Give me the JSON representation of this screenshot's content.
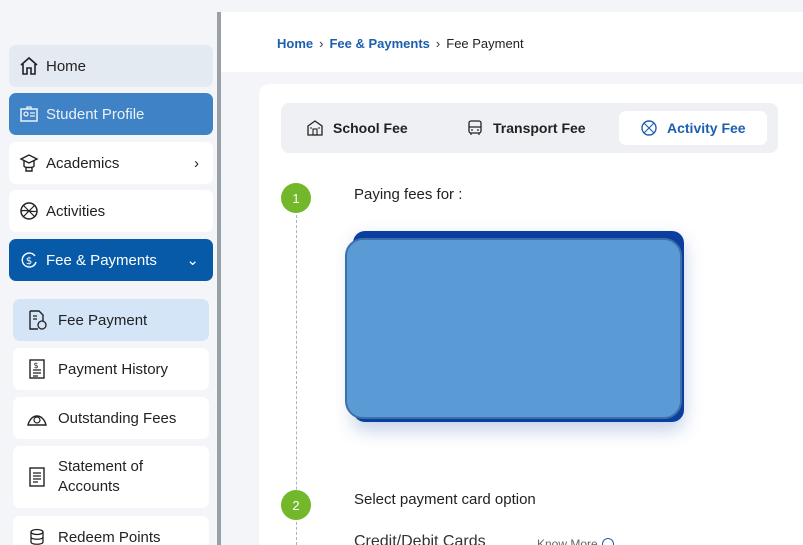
{
  "sidebar": {
    "home": "Home",
    "student_profile": "Student Profile",
    "academics": "Academics",
    "activities": "Activities",
    "fee_payments": "Fee & Payments",
    "sub": {
      "fee_payment": "Fee Payment",
      "payment_history": "Payment History",
      "outstanding_fees": "Outstanding Fees",
      "statement_line1": "Statement of",
      "statement_line2": "Accounts",
      "redeem_points": "Redeem Points"
    }
  },
  "breadcrumb": {
    "home": "Home",
    "section": "Fee & Payments",
    "current": "Fee Payment"
  },
  "tabs": {
    "school": "School Fee",
    "transport": "Transport Fee",
    "activity": "Activity Fee"
  },
  "steps": {
    "one_number": "1",
    "one_title": "Paying fees for :",
    "two_number": "2",
    "two_title": "Select payment card option",
    "card_option": "Credit/Debit Cards",
    "know_more": "Know More"
  },
  "colors": {
    "primary": "#075aa8",
    "accent_green": "#73b82a",
    "profile_active": "#3f82c6"
  }
}
